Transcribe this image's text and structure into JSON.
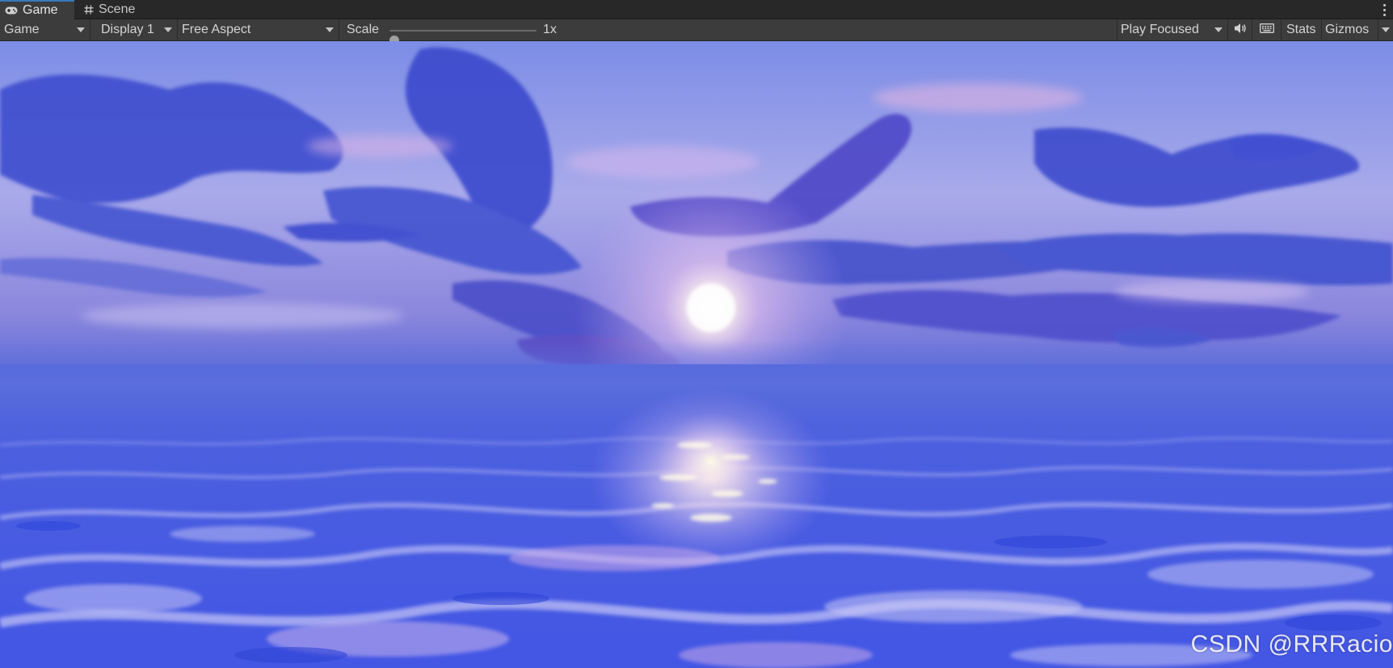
{
  "tabs": {
    "game": {
      "label": "Game",
      "icon": "gamepad-icon",
      "active": true
    },
    "scene": {
      "label": "Scene",
      "icon": "hash-icon",
      "active": false
    }
  },
  "toolbar": {
    "view_dropdown": "Game",
    "display_dropdown": "Display 1",
    "aspect_dropdown": "Free Aspect",
    "scale": {
      "label": "Scale",
      "value_label": "1x",
      "value": 0
    },
    "play_mode_dropdown": "Play Focused",
    "audio_icon": "speaker-icon",
    "keyboard_icon": "keyboard-icon",
    "stats_label": "Stats",
    "gizmos_label": "Gizmos"
  },
  "viewport": {
    "watermark": "CSDN @RRRacio"
  },
  "colors": {
    "tab_bar": "#282828",
    "toolbar": "#3c3c3c",
    "active_tab_accent": "#3a79bb",
    "sky_top": "#7d8fe8",
    "sea": "#4559e2"
  }
}
